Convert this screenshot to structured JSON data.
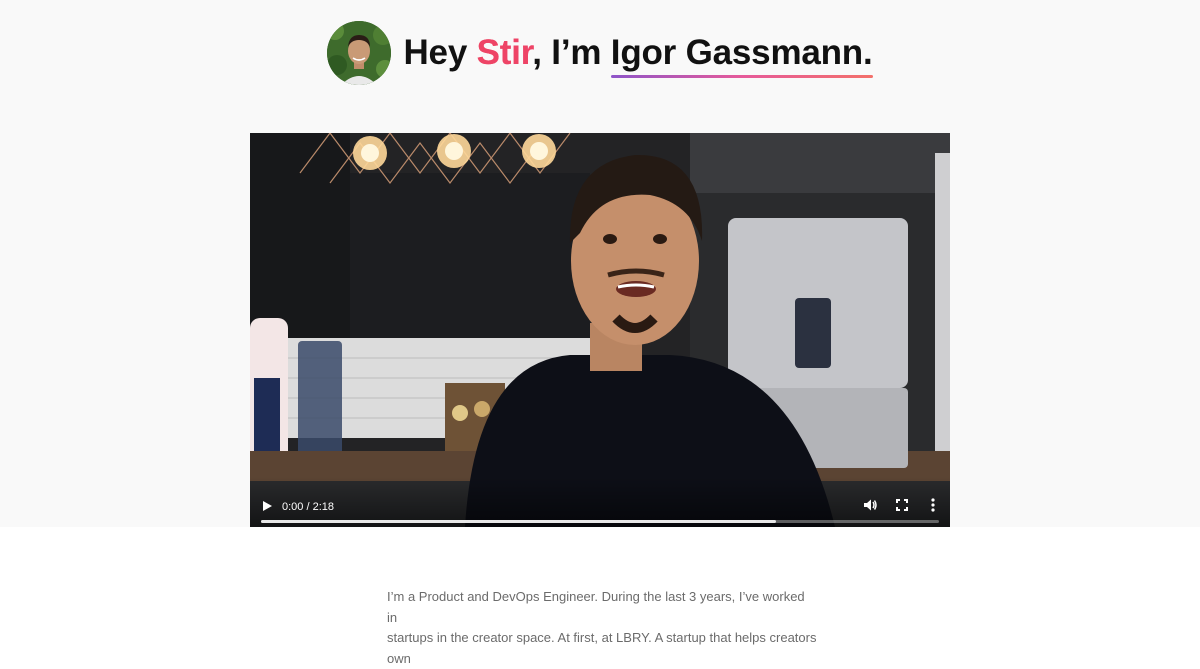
{
  "header": {
    "greeting": "Hey ",
    "company": "Stir",
    "mid": ", I’m ",
    "name": "Igor Gassmann.",
    "avatar_icon": "avatar-photo"
  },
  "video": {
    "time": "0:00 / 2:18",
    "progress_buffered": 0.76,
    "play_icon": "play-icon",
    "volume_icon": "volume-icon",
    "fullscreen_icon": "fullscreen-icon",
    "more_icon": "more-vertical-icon"
  },
  "bio": {
    "line1": "I’m a Product and DevOps Engineer. During the last 3 years, I’ve worked in",
    "line2": "startups in the creator space. At first, at LBRY. A startup that helps creators own"
  },
  "colors": {
    "company_gradient_start": "#f0524f",
    "company_gradient_end": "#e83e8c",
    "underline_gradient": [
      "#8e55c9",
      "#e65a9a",
      "#f3706a"
    ],
    "hero_background": "#f9f9f9"
  }
}
